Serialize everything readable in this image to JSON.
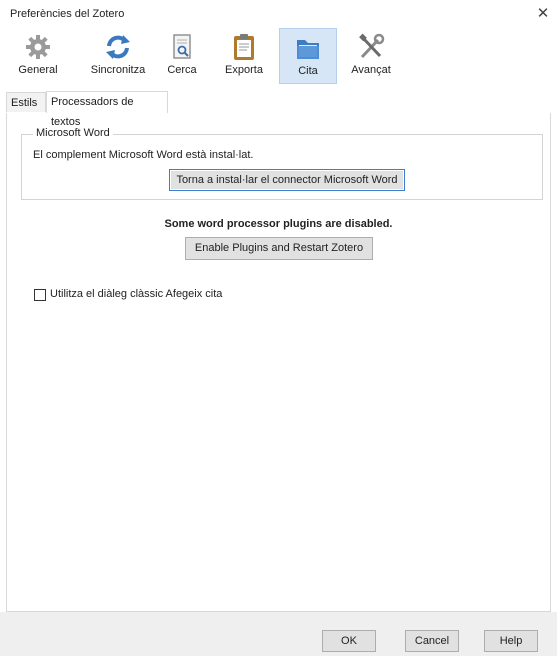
{
  "window": {
    "title": "Preferències del Zotero",
    "close_glyph": "✕"
  },
  "toolbar": {
    "items": [
      {
        "label": "General",
        "icon": "gear-icon"
      },
      {
        "label": "Sincronitza",
        "icon": "sync-icon"
      },
      {
        "label": "Cerca",
        "icon": "search-document-icon"
      },
      {
        "label": "Exporta",
        "icon": "clipboard-icon"
      },
      {
        "label": "Cita",
        "icon": "folder-icon",
        "active": true
      },
      {
        "label": "Avançat",
        "icon": "tools-icon"
      }
    ]
  },
  "tabs": [
    {
      "label": "Estils"
    },
    {
      "label": "Processadors de textos",
      "active": true
    }
  ],
  "word_group": {
    "legend": "Microsoft Word",
    "status": "El complement Microsoft Word està instal·lat.",
    "reinstall_button": "Torna a instal·lar el connector Microsoft Word"
  },
  "plugins": {
    "warning": "Some word processor plugins are disabled.",
    "enable_button": "Enable Plugins and Restart Zotero"
  },
  "options": {
    "classic_dialog_label": "Utilitza el diàleg clàssic Afegeix cita",
    "classic_dialog_checked": false
  },
  "footer": {
    "ok": "OK",
    "cancel": "Cancel",
    "help": "Help"
  },
  "colors": {
    "active_tab_bg": "#d7e6f7",
    "focus_border": "#3c7fd1",
    "footer_bg": "#efefef"
  }
}
